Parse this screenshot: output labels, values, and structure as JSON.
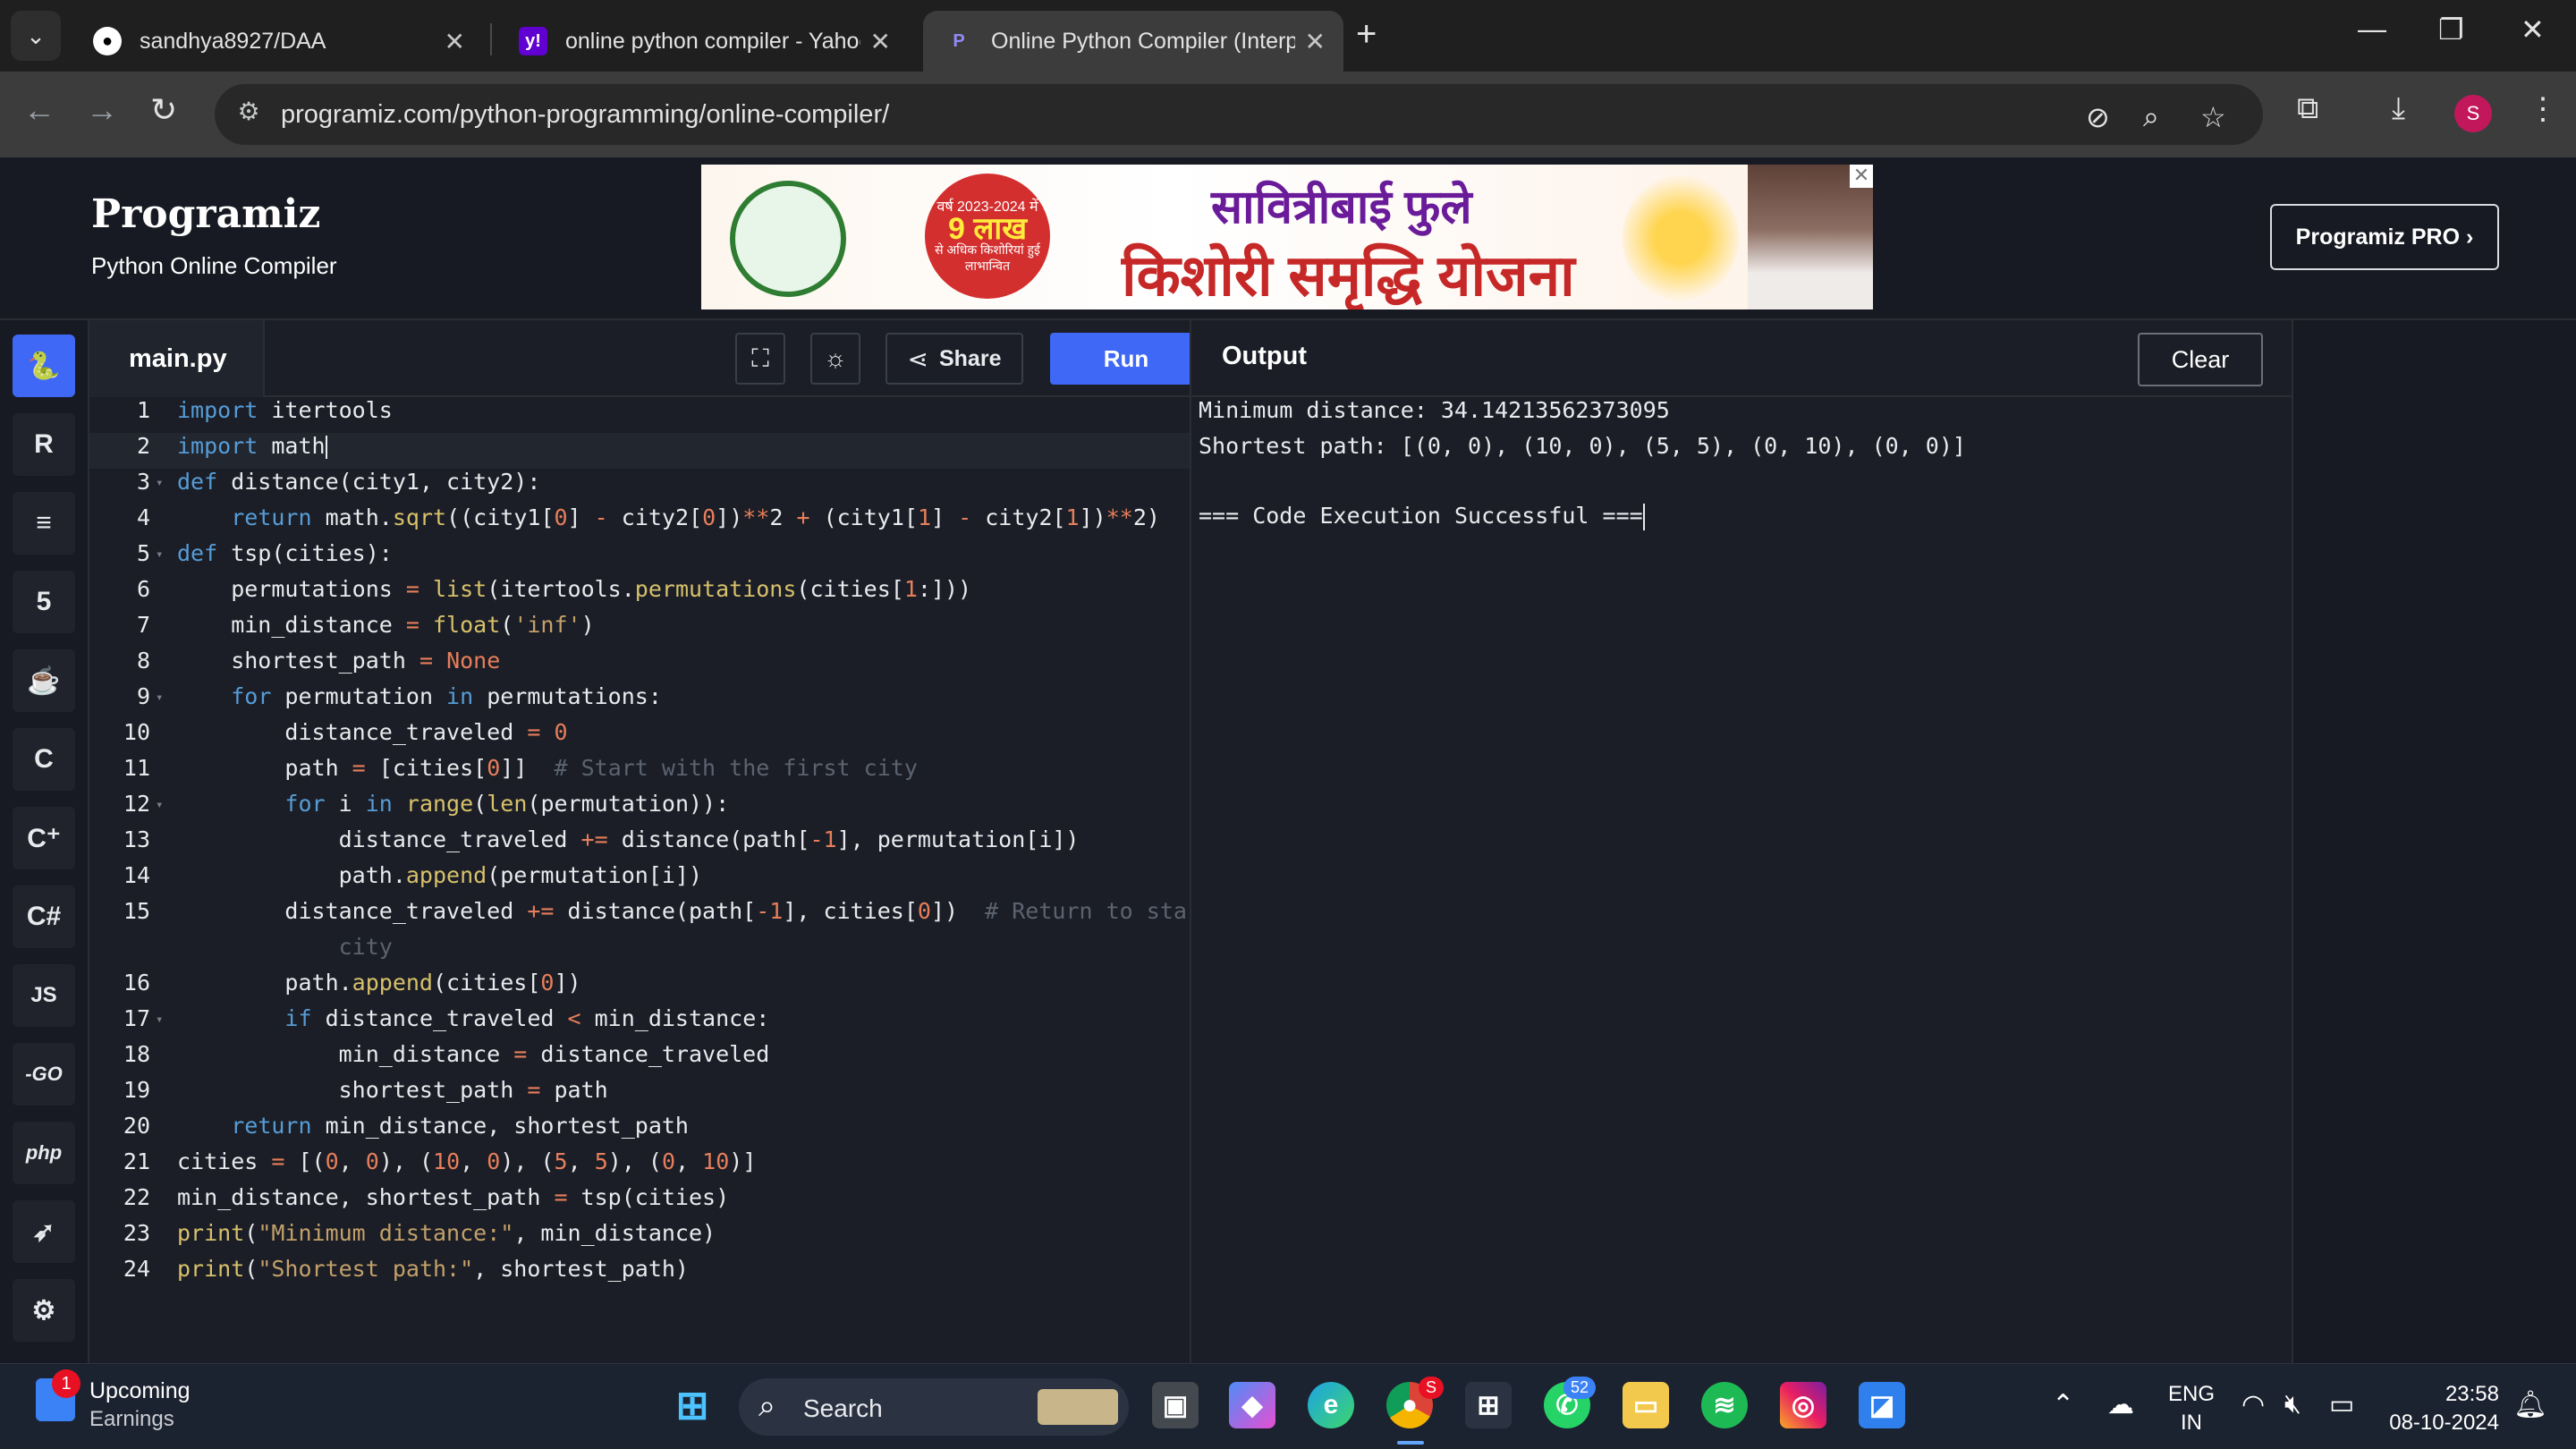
{
  "browser": {
    "tabs": [
      {
        "title": "sandhya8927/DAA",
        "icon": "github-icon"
      },
      {
        "title": "online python compiler - Yahoo",
        "icon": "yahoo-icon"
      },
      {
        "title": "Online Python Compiler (Interp",
        "icon": "programiz-icon",
        "active": true
      }
    ],
    "url": "programiz.com/python-programming/online-compiler/",
    "profile_initial": "S"
  },
  "header": {
    "logo": "Programiz",
    "subtitle": "Python Online Compiler",
    "pro_button": "Programiz PRO ›",
    "ad": {
      "burst_top": "वर्ष 2023-2024 में",
      "burst_big": "9 लाख",
      "burst_bottom": "से अधिक किशोरियां हुई लाभान्वित",
      "line1": "सावित्रीबाई फुले",
      "line2": "किशोरी समृद्धि योजना"
    }
  },
  "languages": [
    "python-icon",
    "r-icon",
    "sql-icon",
    "html5-icon",
    "java-icon",
    "c-icon",
    "cpp-icon",
    "csharp-icon",
    "javascript-icon",
    "go-icon",
    "php-icon",
    "swift-icon",
    "rust-icon"
  ],
  "language_labels": {
    "javascript": "JS",
    "go": "-GO",
    "php": "php"
  },
  "editor": {
    "filename": "main.py",
    "share_label": "Share",
    "run_label": "Run",
    "lines": [
      "1",
      "2",
      "3",
      "4",
      "5",
      "6",
      "7",
      "8",
      "9",
      "10",
      "11",
      "12",
      "13",
      "14",
      "15",
      "",
      "16",
      "17",
      "18",
      "19",
      "20",
      "21",
      "22",
      "23",
      "24"
    ]
  },
  "output": {
    "title": "Output",
    "clear_label": "Clear",
    "lines": [
      "Minimum distance: 34.14213562373095",
      "Shortest path: [(0, 0), (10, 0), (5, 5), (0, 10), (0, 0)]",
      "",
      "=== Code Execution Successful ==="
    ]
  },
  "taskbar": {
    "weather_title": "Upcoming",
    "weather_sub": "Earnings",
    "weather_badge": "1",
    "search_placeholder": "Search",
    "whatsapp_badge": "52",
    "chrome_badge": "S",
    "lang_top": "ENG",
    "lang_bottom": "IN",
    "time": "23:58",
    "date": "08-10-2024"
  }
}
